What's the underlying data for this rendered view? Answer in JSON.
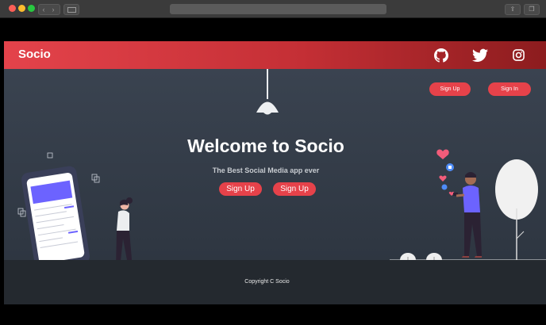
{
  "browser": {
    "nav_back": "‹",
    "nav_forward": "›"
  },
  "navbar": {
    "brand": "Socio",
    "icons": [
      "github-icon",
      "twitter-icon",
      "instagram-icon"
    ]
  },
  "hero": {
    "title": "Welcome to Socio",
    "subtitle": "The Best Social Media app ever",
    "top_buttons": {
      "signup": "Sign Up",
      "signin": "Sign In"
    },
    "cta_buttons": {
      "signup_1": "Sign Up",
      "signup_2": "Sign Up"
    }
  },
  "footer": {
    "copyright": "Copyright C Socio"
  },
  "colors": {
    "accent": "#e6424a",
    "navbar_dark": "#8c1c1e",
    "hero_bg": "#343c47",
    "phone_screen_accent": "#6c63ff"
  }
}
